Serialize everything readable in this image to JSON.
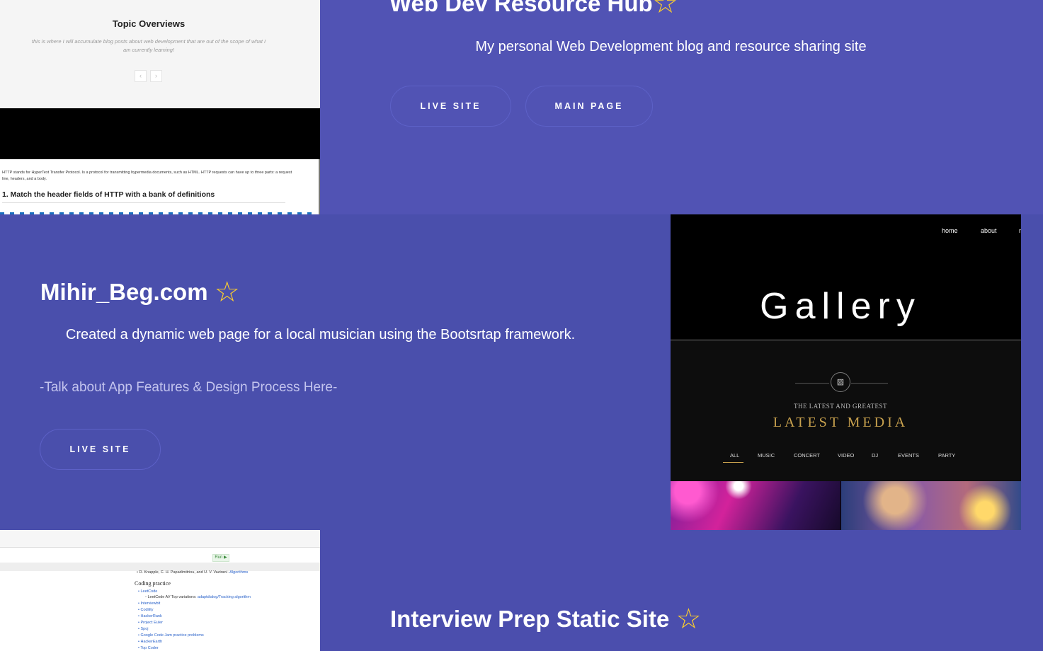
{
  "project1": {
    "title": "Web Dev Resource Hub",
    "star": "☆",
    "description": "My personal Web Development blog and resource sharing site",
    "buttons": [
      "LIVE SITE",
      "MAIN PAGE"
    ],
    "screenshot": {
      "heading": "Topic Overviews",
      "subtitle": "this is where I will accumulate blog posts about web development that are out of the scope of what I am currently learning!",
      "prev": "‹",
      "next": "›",
      "body_text": "HTTP stands for HyperText Transfer Protocol. Is a protocol for transmitting hypermedia documents, such as HTML. HTTP requests can have up to three parts: a request line, headers, and a body.",
      "question": "1. Match the header fields of HTTP with a bank of definitions"
    }
  },
  "project2": {
    "title": "Mihir_Beg.com",
    "star": "☆",
    "description": "Created a dynamic web page for a local musician using the Bootsrtap framework.",
    "note": "-Talk about App Features & Design Process Here-",
    "button": "LIVE SITE",
    "screenshot": {
      "nav": [
        "home",
        "about",
        "m"
      ],
      "heading": "Gallery",
      "image_icon": "▨",
      "kicker": "THE LATEST AND GREATEST",
      "section_title": "LATEST MEDIA",
      "filters": [
        "ALL",
        "MUSIC",
        "CONCERT",
        "VIDEO",
        "DJ",
        "EVENTS",
        "PARTY"
      ]
    }
  },
  "project3": {
    "title": "Interview Prep Static Site",
    "star": "☆",
    "screenshot": {
      "run": "Run ▶",
      "line1": "• D. Knapple, C. H. Papadimitriou, and U. V. Vazirani -",
      "line1_link": "Algorithms",
      "section": "Coding practice",
      "items": [
        "LeetCode",
        "Interviewbit",
        "Codility",
        "HackerRank",
        "Project Euler",
        "Spoj",
        "Google Code Jam practice problems",
        "HackerEarth",
        "Top Coder"
      ],
      "sub_item": "LeetCode AV Top variations:",
      "sub_item_link": "adaptdialog/Tracking algorithm"
    }
  },
  "colors": {
    "band": "#5153b4",
    "star": "#ffd02a",
    "gold": "#c9a24e"
  }
}
